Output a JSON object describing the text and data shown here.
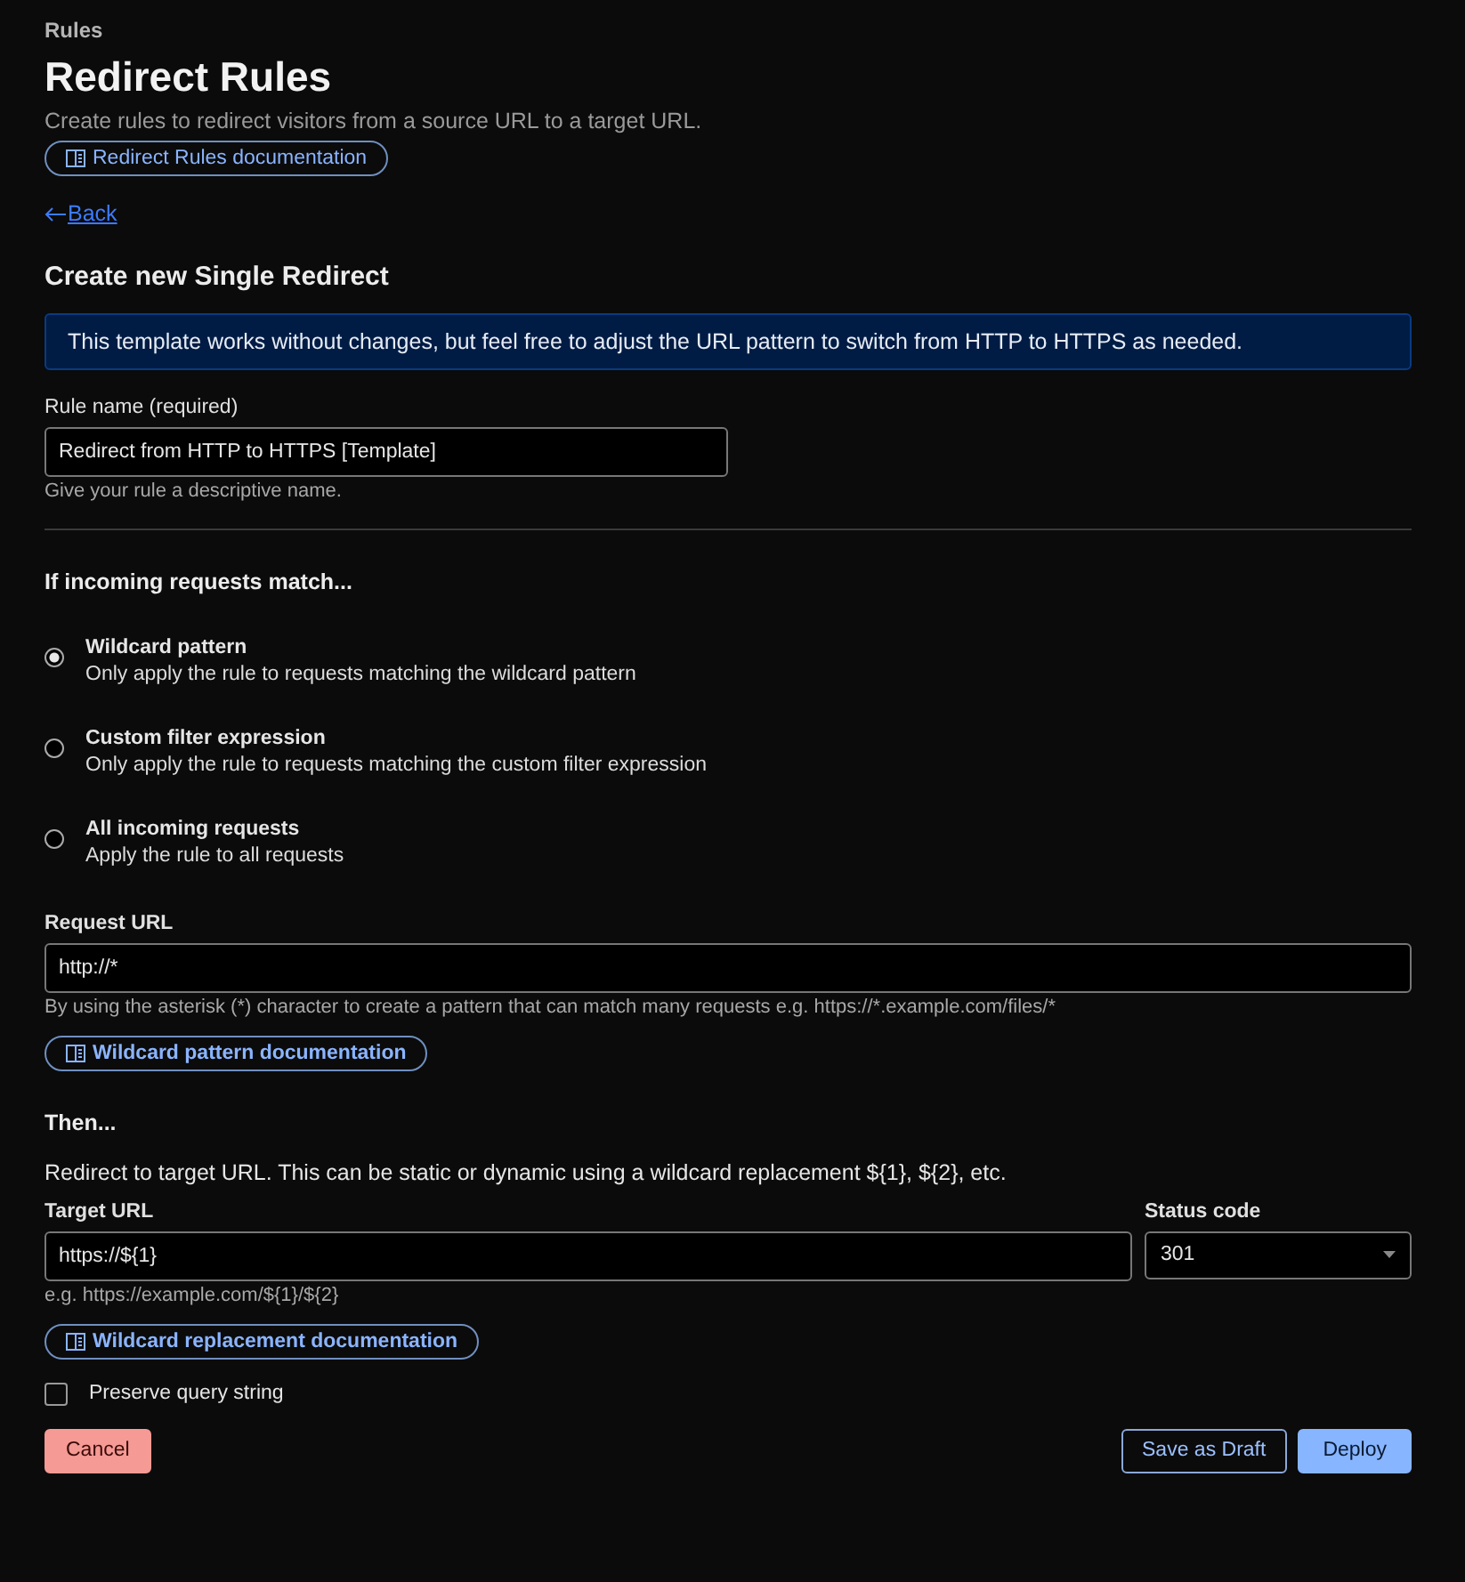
{
  "breadcrumb": "Rules",
  "title": "Redirect Rules",
  "description": "Create rules to redirect visitors from a source URL to a target URL.",
  "docs_link": "Redirect Rules documentation",
  "back_link": "Back",
  "section_title": "Create new Single Redirect",
  "banner": "This template works without changes, but feel free to adjust the URL pattern to switch from HTTP to HTTPS as needed.",
  "rule_name": {
    "label": "Rule name (required)",
    "value": "Redirect from HTTP to HTTPS [Template]",
    "hint": "Give your rule a descriptive name."
  },
  "match_heading": "If incoming requests match...",
  "match_options": [
    {
      "label": "Wildcard pattern",
      "description": "Only apply the rule to requests matching the wildcard pattern",
      "selected": true
    },
    {
      "label": "Custom filter expression",
      "description": "Only apply the rule to requests matching the custom filter expression",
      "selected": false
    },
    {
      "label": "All incoming requests",
      "description": "Apply the rule to all requests",
      "selected": false
    }
  ],
  "request_url": {
    "label": "Request URL",
    "value": "http://*",
    "hint": "By using the asterisk (*) character to create a pattern that can match many requests e.g. https://*.example.com/files/*",
    "docs_link": "Wildcard pattern documentation"
  },
  "then_heading": "Then...",
  "then_description": "Redirect to target URL. This can be static or dynamic using a wildcard replacement ${1}, ${2}, etc.",
  "target_url": {
    "label": "Target URL",
    "value": "https://${1}",
    "hint": "e.g. https://example.com/${1}/${2}",
    "docs_link": "Wildcard replacement documentation"
  },
  "status_code": {
    "label": "Status code",
    "value": "301"
  },
  "preserve_query": {
    "label": "Preserve query string",
    "checked": false
  },
  "buttons": {
    "cancel": "Cancel",
    "draft": "Save as Draft",
    "deploy": "Deploy"
  }
}
